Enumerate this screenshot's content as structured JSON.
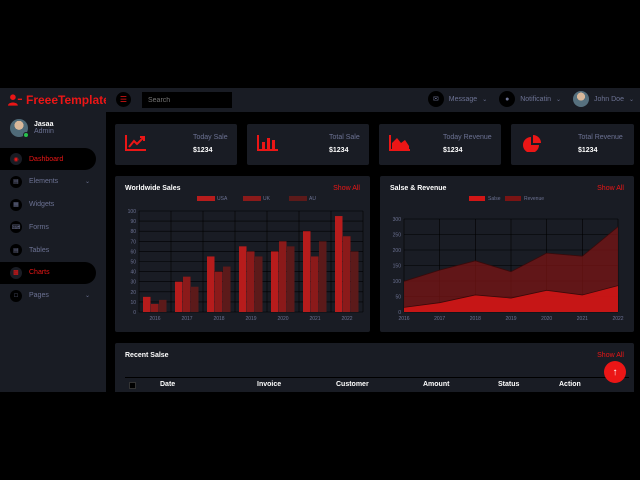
{
  "brand": {
    "name": "FreeeTemplate",
    "icon": "user-icon",
    "color": "#eb1616"
  },
  "user": {
    "name": "Jasaa",
    "role": "Admin"
  },
  "sidebar": {
    "items": [
      {
        "label": "Dashboard",
        "icon": "gauge-icon",
        "active": true,
        "has_dropdown": false
      },
      {
        "label": "Elements",
        "icon": "laptop-icon",
        "active": false,
        "has_dropdown": true
      },
      {
        "label": "Widgets",
        "icon": "grid-icon",
        "active": false,
        "has_dropdown": false
      },
      {
        "label": "Forms",
        "icon": "keyboard-icon",
        "active": false,
        "has_dropdown": false
      },
      {
        "label": "Tables",
        "icon": "table-icon",
        "active": false,
        "has_dropdown": false
      },
      {
        "label": "Charts",
        "icon": "chart-icon",
        "active": false,
        "has_dropdown": false
      },
      {
        "label": "Pages",
        "icon": "file-icon",
        "active": false,
        "has_dropdown": true
      }
    ]
  },
  "topbar": {
    "search_placeholder": "Search",
    "message_label": "Message",
    "notification_label": "Notificatin",
    "profile_name": "John Doe"
  },
  "stats": [
    {
      "label": "Today Sale",
      "value": "$1234",
      "icon": "line-chart-icon"
    },
    {
      "label": "Total Sale",
      "value": "$1234",
      "icon": "bar-chart-icon"
    },
    {
      "label": "Today Revenue",
      "value": "$1234",
      "icon": "area-chart-icon"
    },
    {
      "label": "Total Revenue",
      "value": "$1234",
      "icon": "pie-chart-icon"
    }
  ],
  "worldwide": {
    "title": "Worldwide Sales",
    "show_all": "Show All"
  },
  "salesrev": {
    "title": "Salse & Revenue",
    "show_all": "Show All"
  },
  "recent": {
    "title": "Recent Salse",
    "show_all": "Show All",
    "columns": [
      "Date",
      "Invoice",
      "Customer",
      "Amount",
      "Status",
      "Action"
    ]
  },
  "colors": {
    "accent": "#eb1616",
    "panel": "#191c24",
    "bg": "#000000",
    "muted": "#6c7293"
  },
  "chart_data": [
    {
      "type": "bar",
      "title": "Worldwide Sales",
      "categories": [
        "2016",
        "2017",
        "2018",
        "2019",
        "2020",
        "2021",
        "2022"
      ],
      "series": [
        {
          "name": "USA",
          "color": "#b71c1c",
          "values": [
            15,
            30,
            55,
            65,
            60,
            80,
            95
          ]
        },
        {
          "name": "UK",
          "color": "#8b1a1a",
          "values": [
            8,
            35,
            40,
            60,
            70,
            55,
            75
          ]
        },
        {
          "name": "AU",
          "color": "#5c1a1a",
          "values": [
            12,
            25,
            45,
            55,
            65,
            70,
            60
          ]
        }
      ],
      "ylim": [
        0,
        100
      ],
      "yticks": [
        0,
        10,
        20,
        30,
        40,
        50,
        60,
        70,
        80,
        90,
        100
      ],
      "legend": "top-center",
      "grid": true
    },
    {
      "type": "area",
      "title": "Salse & Revenue",
      "categories": [
        "2016",
        "2017",
        "2018",
        "2019",
        "2020",
        "2021",
        "2022"
      ],
      "series": [
        {
          "name": "Salse",
          "color": "#d21616",
          "values": [
            15,
            30,
            55,
            45,
            70,
            55,
            85
          ]
        },
        {
          "name": "Revenue",
          "color": "#7a1414",
          "values": [
            99,
            135,
            165,
            130,
            190,
            180,
            275
          ]
        }
      ],
      "ylim": [
        0,
        300
      ],
      "yticks": [
        0,
        50,
        100,
        150,
        200,
        250,
        300
      ],
      "legend": "top-center",
      "grid": true
    }
  ]
}
